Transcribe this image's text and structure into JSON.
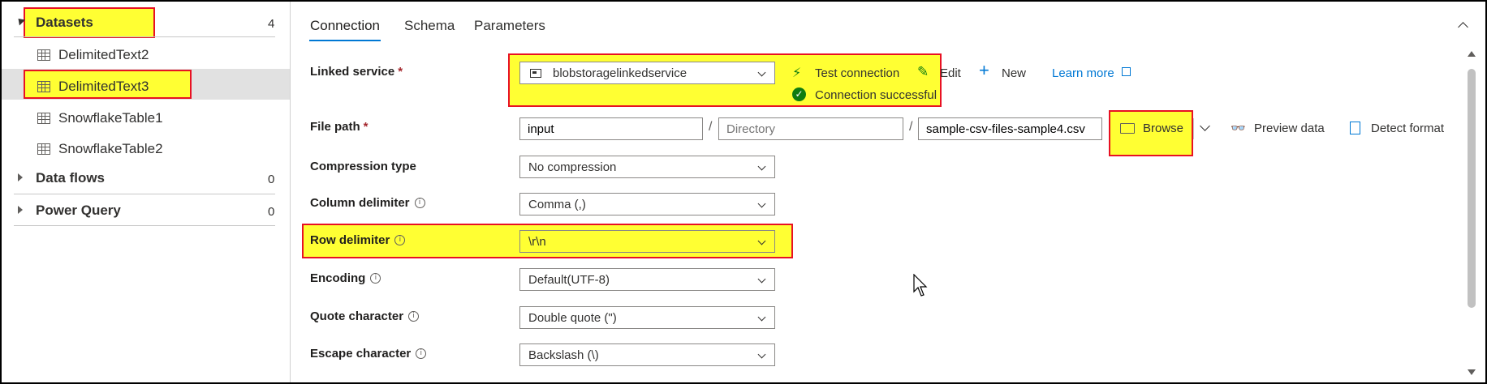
{
  "sidebar": {
    "datasets_label": "Datasets",
    "datasets_count": "4",
    "items": [
      "DelimitedText2",
      "DelimitedText3",
      "SnowflakeTable1",
      "SnowflakeTable2"
    ],
    "data_flows_label": "Data flows",
    "data_flows_count": "0",
    "power_query_label": "Power Query",
    "power_query_count": "0"
  },
  "tabs": [
    "Connection",
    "Schema",
    "Parameters"
  ],
  "form": {
    "linked_service": {
      "label": "Linked service",
      "value": "blobstoragelinkedservice",
      "test_connection": "Test connection",
      "edit": "Edit",
      "new": "New",
      "learn_more": "Learn more",
      "status": "Connection successful"
    },
    "file_path": {
      "label": "File path",
      "container": "input",
      "directory_placeholder": "Directory",
      "file": "sample-csv-files-sample4.csv",
      "browse": "Browse",
      "preview": "Preview data",
      "detect": "Detect format"
    },
    "compression_type": {
      "label": "Compression type",
      "value": "No compression"
    },
    "column_delimiter": {
      "label": "Column delimiter",
      "value": "Comma (,)"
    },
    "row_delimiter": {
      "label": "Row delimiter",
      "value": "\\r\\n"
    },
    "encoding": {
      "label": "Encoding",
      "value": "Default(UTF-8)"
    },
    "quote_character": {
      "label": "Quote character",
      "value": "Double quote (\")"
    },
    "escape_character": {
      "label": "Escape character",
      "value": "Backslash (\\)"
    }
  },
  "colors": {
    "highlight": "#ffff33",
    "annotation_border": "#e81123",
    "accent": "#0078d4",
    "success": "#107c10"
  }
}
